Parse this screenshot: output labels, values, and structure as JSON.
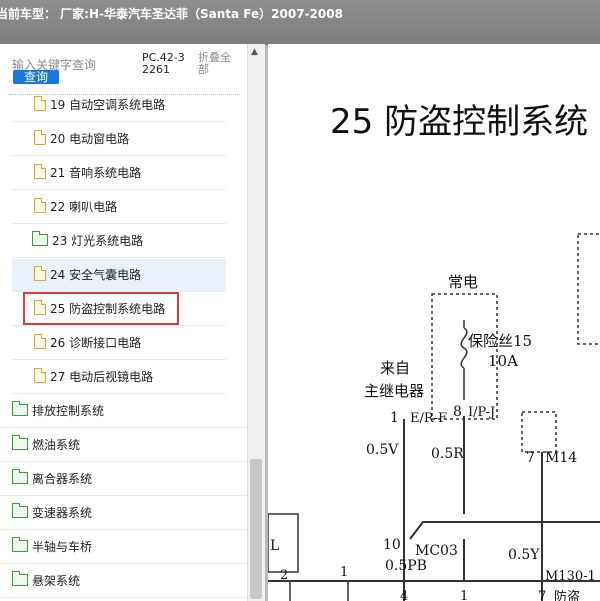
{
  "window": {
    "title": "当前车型： 厂家:H-华泰汽车圣达菲（Santa Fe）2007-2008"
  },
  "search": {
    "placeholder": "输入关键字查询",
    "button_label": "查询",
    "code": "PC.42-32261",
    "collapse_label": "折叠全部"
  },
  "sidebar": {
    "sub_items": [
      {
        "label": "19 自动空调系统电路",
        "icon": "file-icon"
      },
      {
        "label": "20 电动窗电路",
        "icon": "file-icon"
      },
      {
        "label": "21 音响系统电路",
        "icon": "file-icon"
      },
      {
        "label": "22 喇叭电路",
        "icon": "file-icon"
      },
      {
        "label": "23 灯光系统电路",
        "icon": "folder-icon"
      },
      {
        "label": "24 安全气囊电路",
        "icon": "file-icon"
      },
      {
        "label": "25 防盗控制系统电路",
        "icon": "file-icon",
        "selected": true
      },
      {
        "label": "26 诊断接口电路",
        "icon": "file-icon"
      },
      {
        "label": "27 电动后视镜电路",
        "icon": "file-icon"
      }
    ],
    "top_items": [
      {
        "label": "排放控制系统",
        "icon": "folder-icon"
      },
      {
        "label": "燃油系统",
        "icon": "folder-icon"
      },
      {
        "label": "离合器系统",
        "icon": "folder-icon"
      },
      {
        "label": "变速器系统",
        "icon": "folder-icon"
      },
      {
        "label": "半轴与车桥",
        "icon": "folder-icon"
      },
      {
        "label": "悬架系统",
        "icon": "folder-icon"
      }
    ]
  },
  "document": {
    "heading": "25 防盗控制系统",
    "diagram": {
      "changdian": "常电",
      "fuse_name": "保险丝15",
      "fuse_rating": "10A",
      "laizi": "来自",
      "relay": "主继电器",
      "pin1": "1",
      "pin1_name": "E/R-F",
      "pin8": "8",
      "pin8_name": "I/P-J",
      "wire1": "0.5V",
      "wire2": "0.5R",
      "pin7": "7",
      "m14": "M14",
      "l_label": "L",
      "pin10": "10",
      "mc03": "MC03",
      "wire3": "0.5PB",
      "wire4": "0.5Y",
      "pin2": "2",
      "pin1b": "1",
      "m130": "M130-1",
      "pin4": "4",
      "pin1c": "1",
      "pin7b": "7",
      "fangdao": "防盗"
    }
  }
}
